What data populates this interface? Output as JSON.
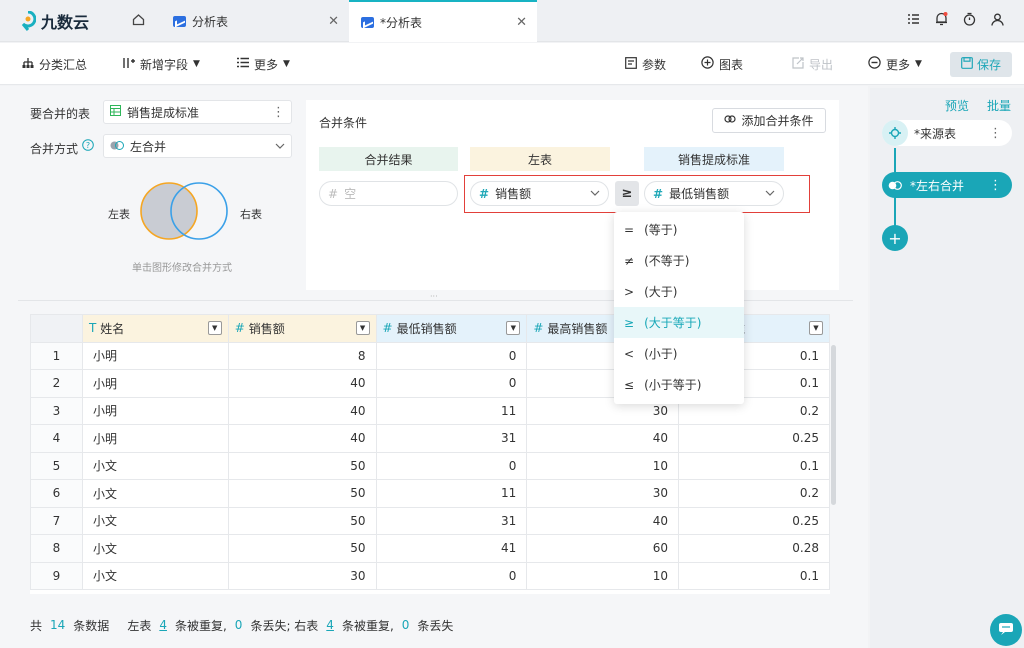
{
  "app": {
    "name": "九数云"
  },
  "tabs": [
    {
      "label": "分析表"
    },
    {
      "label": "*分析表"
    }
  ],
  "toolbar": {
    "summary": "分类汇总",
    "add_field": "新增字段",
    "more_left": "更多",
    "params": "参数",
    "chart": "图表",
    "export": "导出",
    "more_right": "更多",
    "save": "保存"
  },
  "merge": {
    "table_label": "要合并的表",
    "table_value": "销售提成标准",
    "method_label": "合并方式",
    "method_value": "左合并",
    "venn_left": "左表",
    "venn_right": "右表",
    "venn_hint": "单击图形修改合并方式",
    "cond_title": "合并条件",
    "add_cond": "添加合并条件",
    "col_result": "合并结果",
    "col_left": "左表",
    "col_right": "销售提成标准",
    "result_placeholder": "空",
    "left_field": "销售额",
    "right_field": "最低销售额",
    "operator_symbol": "≥"
  },
  "operators": [
    {
      "symbol": "=",
      "label": "(等于)"
    },
    {
      "symbol": "≠",
      "label": "(不等于)"
    },
    {
      "symbol": ">",
      "label": "(大于)"
    },
    {
      "symbol": "≥",
      "label": "(大于等于)"
    },
    {
      "symbol": "<",
      "label": "(小于)"
    },
    {
      "symbol": "≤",
      "label": "(小于等于)"
    }
  ],
  "table": {
    "columns": [
      {
        "icon": "T",
        "name": "姓名"
      },
      {
        "icon": "#",
        "name": "销售额"
      },
      {
        "icon": "#",
        "name": "最低销售额"
      },
      {
        "icon": "#",
        "name": "最高销售额"
      },
      {
        "icon": "",
        "name": "准"
      }
    ],
    "rows": [
      [
        "1",
        "小明",
        "8",
        "0",
        "",
        "0.1"
      ],
      [
        "2",
        "小明",
        "40",
        "0",
        "",
        "0.1"
      ],
      [
        "3",
        "小明",
        "40",
        "11",
        "30",
        "0.2"
      ],
      [
        "4",
        "小明",
        "40",
        "31",
        "40",
        "0.25"
      ],
      [
        "5",
        "小文",
        "50",
        "0",
        "10",
        "0.1"
      ],
      [
        "6",
        "小文",
        "50",
        "11",
        "30",
        "0.2"
      ],
      [
        "7",
        "小文",
        "50",
        "31",
        "40",
        "0.25"
      ],
      [
        "8",
        "小文",
        "50",
        "41",
        "60",
        "0.28"
      ],
      [
        "9",
        "小文",
        "30",
        "0",
        "10",
        "0.1"
      ]
    ]
  },
  "footer": {
    "t1": "共",
    "count": "14",
    "t2": "条数据",
    "t3": "左表",
    "left_dup": "4",
    "t4": "条被重复,",
    "left_lost": "0",
    "t5": "条丢失; 右表",
    "right_dup": "4",
    "t6": "条被重复,",
    "right_lost": "0",
    "t7": "条丢失"
  },
  "side": {
    "preview": "预览",
    "batch": "批量",
    "node1": "*来源表",
    "node2": "*左右合并"
  }
}
